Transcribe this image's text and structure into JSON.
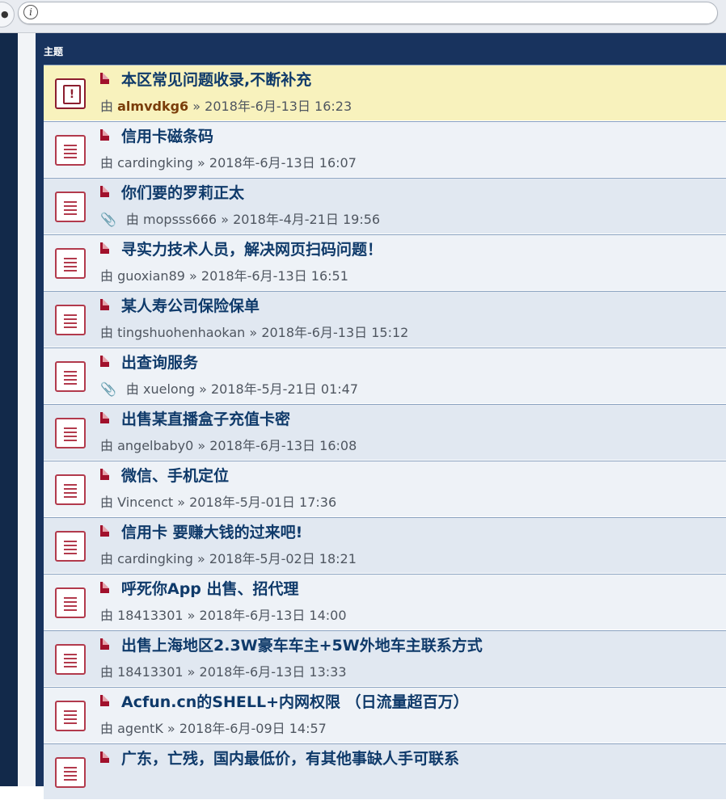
{
  "browser": {
    "info_icon": "i"
  },
  "forum": {
    "header": "主题",
    "topics": [
      {
        "title": "本区常见问题收录,不断补充",
        "by": "由",
        "author": "almvdkg6",
        "sep": "»",
        "date": "2018年-6月-13日 16:23",
        "sticky": true,
        "attachment": false
      },
      {
        "title": "信用卡磁条码",
        "by": "由",
        "author": "cardingking",
        "sep": "»",
        "date": "2018年-6月-13日 16:07",
        "sticky": false,
        "attachment": false
      },
      {
        "title": "你们要的罗莉正太",
        "by": "由",
        "author": "mopsss666",
        "sep": "»",
        "date": "2018年-4月-21日 19:56",
        "sticky": false,
        "attachment": true
      },
      {
        "title": "寻实力技术人员，解决网页扫码问题！",
        "by": "由",
        "author": "guoxian89",
        "sep": "»",
        "date": "2018年-6月-13日 16:51",
        "sticky": false,
        "attachment": false
      },
      {
        "title": "某人寿公司保险保单",
        "by": "由",
        "author": "tingshuohenhaokan",
        "sep": "»",
        "date": "2018年-6月-13日 15:12",
        "sticky": false,
        "attachment": false
      },
      {
        "title": "出查询服务",
        "by": "由",
        "author": "xuelong",
        "sep": "»",
        "date": "2018年-5月-21日 01:47",
        "sticky": false,
        "attachment": true
      },
      {
        "title": "出售某直播盒子充值卡密",
        "by": "由",
        "author": "angelbaby0",
        "sep": "»",
        "date": "2018年-6月-13日 16:08",
        "sticky": false,
        "attachment": false
      },
      {
        "title": "微信、手机定位",
        "by": "由",
        "author": "Vincenct",
        "sep": "»",
        "date": "2018年-5月-01日 17:36",
        "sticky": false,
        "attachment": false
      },
      {
        "title": "信用卡 要赚大钱的过来吧!",
        "by": "由",
        "author": "cardingking",
        "sep": "»",
        "date": "2018年-5月-02日 18:21",
        "sticky": false,
        "attachment": false
      },
      {
        "title": "呼死你App 出售、招代理",
        "by": "由",
        "author": "18413301",
        "sep": "»",
        "date": "2018年-6月-13日 14:00",
        "sticky": false,
        "attachment": false
      },
      {
        "title": "出售上海地区2.3W豪车车主+5W外地车主联系方式",
        "by": "由",
        "author": "18413301",
        "sep": "»",
        "date": "2018年-6月-13日 13:33",
        "sticky": false,
        "attachment": false
      },
      {
        "title": "Acfun.cn的SHELL+内网权限 （日流量超百万）",
        "by": "由",
        "author": "agentK",
        "sep": "»",
        "date": "2018年-6月-09日 14:57",
        "sticky": false,
        "attachment": false
      },
      {
        "title": "广东，亡残，国内最低价，有其他事缺人手可联系",
        "by": "",
        "author": "",
        "sep": "",
        "date": "",
        "sticky": false,
        "attachment": false
      }
    ]
  },
  "icons": {
    "sticky_topic": "announcement-icon",
    "topic": "topic-read-icon",
    "post": "post-icon",
    "attachment": "paperclip-icon"
  },
  "colors": {
    "header_bg": "#18335e",
    "sticky_bg": "#f8f2bd",
    "title": "#0f3a6a",
    "icon_red": "#b23a4c"
  }
}
